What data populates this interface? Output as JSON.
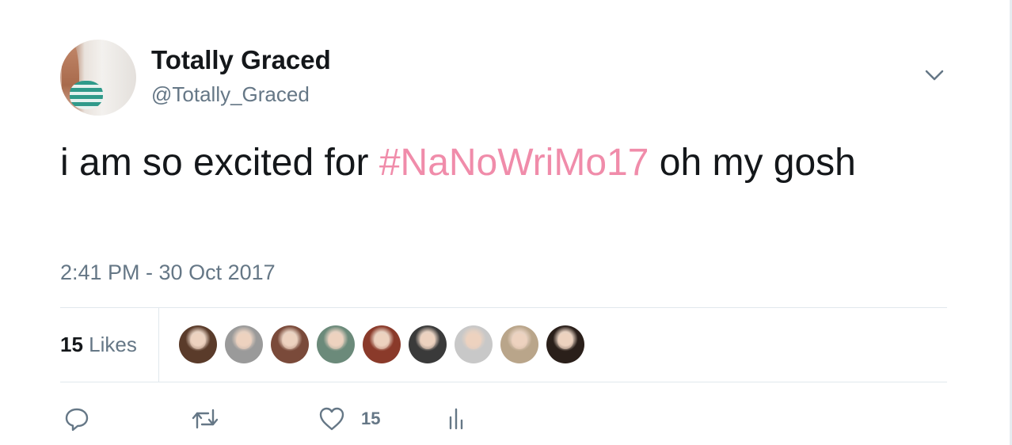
{
  "tweet": {
    "author_name": "Totally Graced",
    "author_handle": "@Totally_Graced",
    "text_before": "i am so excited for ",
    "hashtag": "#NaNoWriMo17",
    "text_after": " oh my gosh",
    "timestamp": "2:41 PM - 30 Oct 2017",
    "like_count": "15",
    "likes_label": "Likes",
    "hashtag_color": "#f08caa"
  },
  "likers": [
    {
      "color": "#5a3b2a"
    },
    {
      "color": "#9a9a9a"
    },
    {
      "color": "#7a4a3a"
    },
    {
      "color": "#6b8a7a"
    },
    {
      "color": "#8a3a2a"
    },
    {
      "color": "#3a3a3a"
    },
    {
      "color": "#c8c8c8"
    },
    {
      "color": "#b9a58a"
    },
    {
      "color": "#2a1f1a"
    }
  ],
  "actions": {
    "reply_icon": "reply-icon",
    "retweet_icon": "retweet-icon",
    "like_icon": "heart-icon",
    "analytics_icon": "analytics-icon",
    "like_count": "15"
  }
}
